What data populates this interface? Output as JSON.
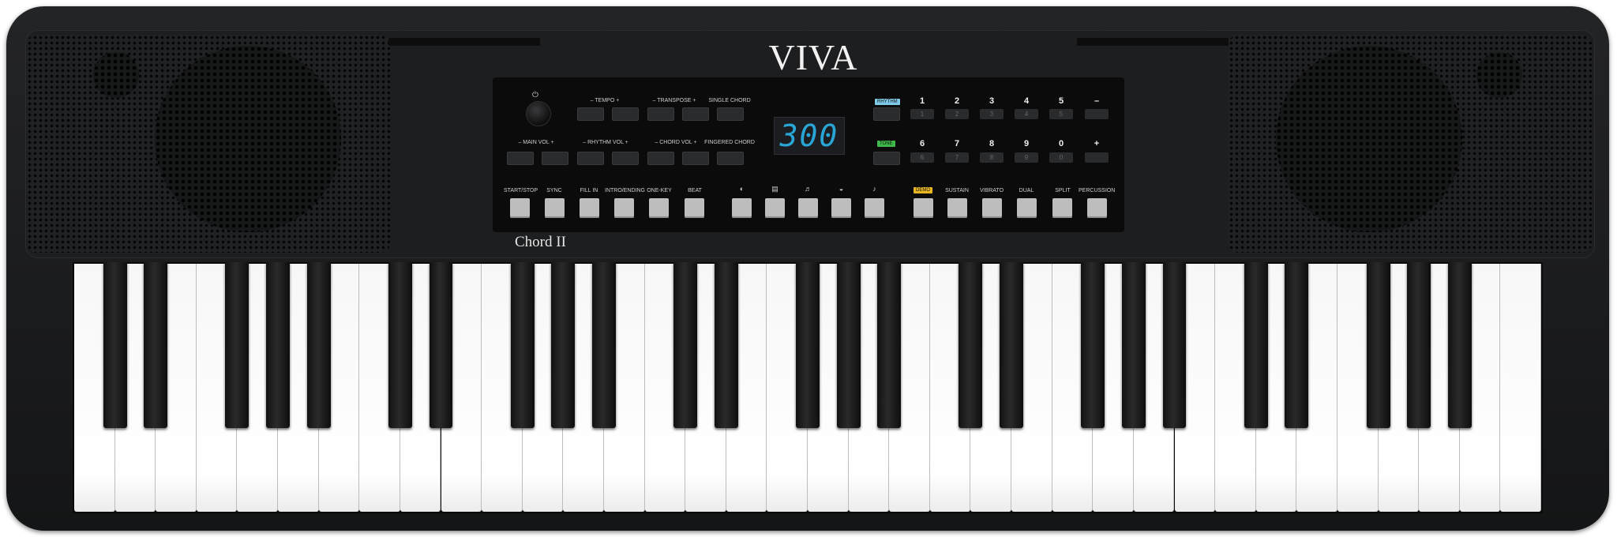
{
  "brand": {
    "logo": "VIVA",
    "model": "Chord II"
  },
  "display": {
    "value": "300"
  },
  "power": {
    "icon": "power-icon",
    "glyph": "⏻"
  },
  "control_panel": {
    "row1": [
      {
        "label": "–  TEMPO  +"
      },
      {
        "label": "–  TRANSPOSE +"
      },
      {
        "label": "SINGLE CHORD"
      }
    ],
    "row2": [
      {
        "label": "–  MAIN VOL  +"
      },
      {
        "label": "– RHYTHM VOL +"
      },
      {
        "label": "–  CHORD VOL  +"
      },
      {
        "label": "FINGERED CHORD"
      }
    ],
    "bottom_labels": [
      "START/STOP",
      "SYNC",
      "FILL IN",
      "INTRO/ENDING",
      "ONE-KEY",
      "BEAT"
    ],
    "voice_icons": [
      {
        "name": "piano-icon",
        "glyph": "◐"
      },
      {
        "name": "organ-icon",
        "glyph": "▤"
      },
      {
        "name": "guitar-icon",
        "glyph": "♬"
      },
      {
        "name": "strings-icon",
        "glyph": "◒"
      },
      {
        "name": "brass-icon",
        "glyph": "♪"
      }
    ],
    "function_labels": [
      "DEMO",
      "SUSTAIN",
      "VIBRATO",
      "DUAL",
      "SPLIT",
      "PERCUSSION"
    ],
    "mode_badges": {
      "rhythm": "RHYTHM",
      "tone": "TONE"
    },
    "number_row1": [
      "1",
      "2",
      "3",
      "4",
      "5",
      "–"
    ],
    "number_row2": [
      "6",
      "7",
      "8",
      "9",
      "0",
      "+"
    ],
    "number_keys_row1": [
      "1",
      "2",
      "3",
      "4",
      "5",
      ""
    ],
    "number_keys_row2": [
      "6",
      "7",
      "8",
      "9",
      "0",
      ""
    ]
  },
  "keyboard": {
    "white_keys": 36,
    "black_keys": 25
  },
  "colors": {
    "display": "#2aa6d6",
    "rhythm_badge": "#7ec9e6",
    "tone_badge": "#3fb84a",
    "demo_badge": "#e8b623"
  }
}
